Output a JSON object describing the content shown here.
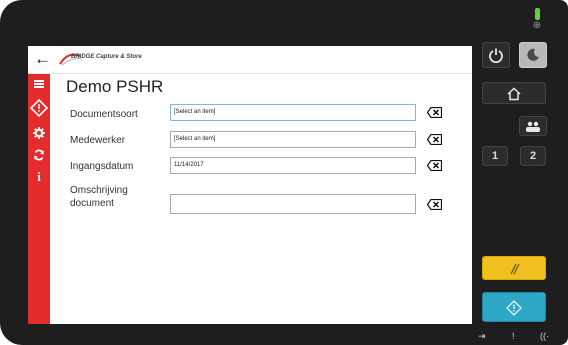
{
  "header": {
    "back_label": "←",
    "logo_text": "BRIDGE Capture & Store"
  },
  "page": {
    "title": "Demo PSHR"
  },
  "form": {
    "fields": [
      {
        "label": "Documentsoort",
        "value": "[Select an item]"
      },
      {
        "label": "Medewerker",
        "value": "[Select an item]"
      },
      {
        "label": "Ingangsdatum",
        "value": "11/14/2017"
      },
      {
        "label": "Omschrijving\ndocument",
        "value": ""
      }
    ]
  },
  "sidebar": {
    "items": [
      {
        "name": "menu-icon",
        "glyph": "≡"
      },
      {
        "name": "scan-icon",
        "glyph": "◇"
      },
      {
        "name": "gear-icon",
        "glyph": "✻"
      },
      {
        "name": "refresh-icon",
        "glyph": "↻"
      },
      {
        "name": "info-icon",
        "glyph": "i"
      }
    ]
  },
  "hardware": {
    "copy_buttons": [
      "1",
      "2"
    ],
    "colors": {
      "sidebar": "#e52c2c",
      "reset_button": "#f0c020",
      "start_button": "#2fa8c8",
      "led": "#5fd23a"
    }
  }
}
